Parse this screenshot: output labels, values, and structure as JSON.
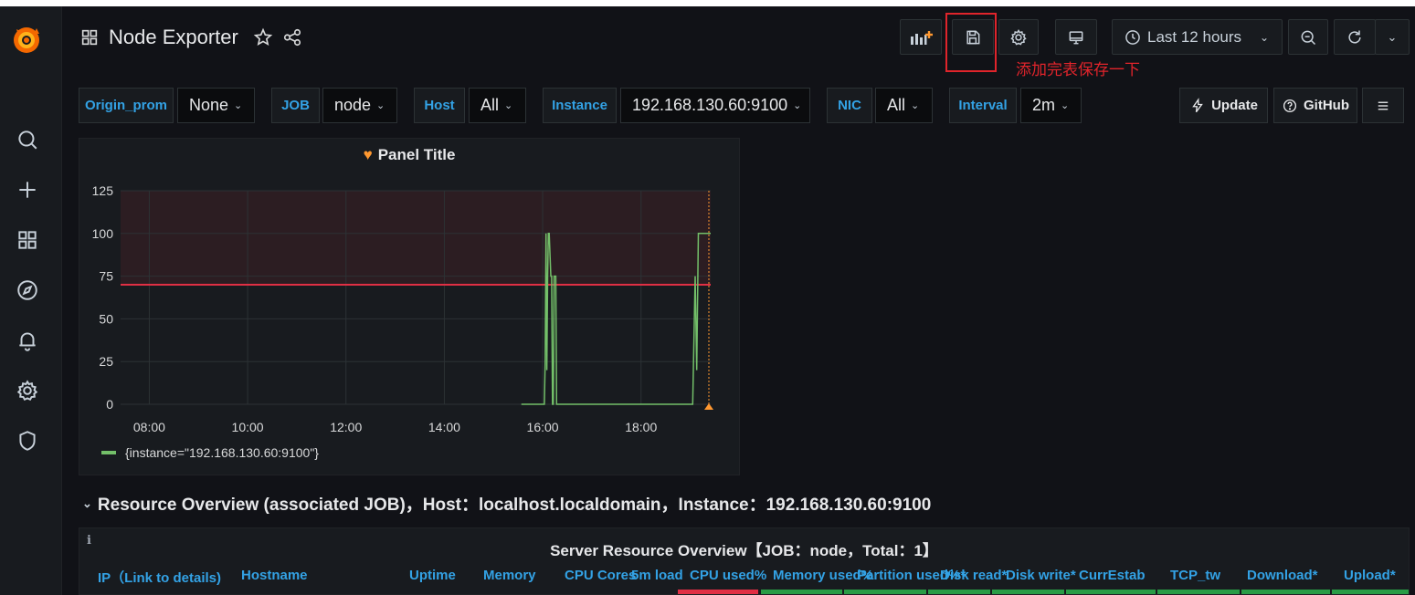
{
  "dashboard": {
    "title": "Node Exporter"
  },
  "toolbar": {
    "time_range": "Last 12 hours",
    "annotation": "添加完表保存一下"
  },
  "variables": [
    {
      "label": "Origin_prom",
      "value": "None"
    },
    {
      "label": "JOB",
      "value": "node"
    },
    {
      "label": "Host",
      "value": "All"
    },
    {
      "label": "Instance",
      "value": "192.168.130.60:9100"
    },
    {
      "label": "NIC",
      "value": "All"
    },
    {
      "label": "Interval",
      "value": "2m"
    }
  ],
  "links": {
    "update": "Update",
    "github": "GitHub"
  },
  "panel": {
    "title": "Panel Title",
    "legend": "{instance=\"192.168.130.60:9100\"}"
  },
  "chart_data": {
    "type": "line",
    "title": "Panel Title",
    "ylim": [
      0,
      125
    ],
    "y_ticks": [
      "0",
      "25",
      "50",
      "75",
      "100",
      "125"
    ],
    "x_ticks": [
      "08:00",
      "10:00",
      "12:00",
      "14:00",
      "16:00",
      "18:00"
    ],
    "x_range": [
      "07:25",
      "19:25"
    ],
    "threshold": 70,
    "threshold_color": "#e02f44",
    "series": [
      {
        "name": "{instance=\"192.168.130.60:9100\"}",
        "color": "#73bf69",
        "points": [
          [
            "15:34",
            0
          ],
          [
            "16:02",
            0
          ],
          [
            "16:03",
            25
          ],
          [
            "16:04",
            100
          ],
          [
            "16:05",
            20
          ],
          [
            "16:06",
            75
          ],
          [
            "16:07",
            100
          ],
          [
            "16:08",
            100
          ],
          [
            "16:10",
            75
          ],
          [
            "16:11",
            75
          ],
          [
            "16:12",
            0
          ],
          [
            "16:13",
            0
          ],
          [
            "16:14",
            75
          ],
          [
            "16:16",
            75
          ],
          [
            "16:17",
            0
          ],
          [
            "19:03",
            0
          ],
          [
            "19:06",
            75
          ],
          [
            "19:08",
            20
          ],
          [
            "19:10",
            100
          ],
          [
            "19:25",
            100
          ]
        ]
      }
    ]
  },
  "row": {
    "title": "Resource Overview (associated JOB)，Host：localhost.localdomain，Instance：192.168.130.60:9100"
  },
  "table": {
    "info": "i",
    "title": "Server Resource Overview【JOB：node，Total：1】",
    "columns": [
      "IP（Link to details)",
      "Hostname",
      "Uptime",
      "Memory",
      "CPU Cores",
      "5m load",
      "CPU used%",
      "Memory used%",
      "Partition used%*",
      "Disk read*",
      "Disk write*",
      "CurrEstab",
      "TCP_tw",
      "Download*",
      "Upload*"
    ],
    "cell_status": [
      "",
      "",
      "",
      "",
      "",
      "",
      "red",
      "green",
      "green",
      "green",
      "green",
      "green",
      "green",
      "green",
      "green"
    ]
  },
  "colors": {
    "red": "#e02f44",
    "green": "#299c46"
  }
}
